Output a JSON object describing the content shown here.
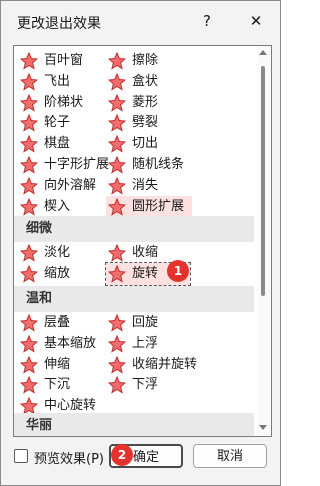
{
  "window": {
    "title": "更改退出效果",
    "help_label": "?",
    "close_label": "✕"
  },
  "groups": {
    "basic": {
      "items": [
        "百叶窗",
        "擦除",
        "飞出",
        "盒状",
        "阶梯状",
        "菱形",
        "轮子",
        "劈裂",
        "棋盘",
        "切出",
        "十字形扩展",
        "随机线条",
        "向外溶解",
        "消失",
        "楔入",
        "圆形扩展"
      ]
    },
    "subtle": {
      "label": "细微",
      "items": [
        "淡化",
        "收缩",
        "缩放",
        "旋转"
      ]
    },
    "moderate": {
      "label": "温和",
      "items": [
        "层叠",
        "回旋",
        "基本缩放",
        "上浮",
        "伸缩",
        "收缩并旋转",
        "下沉",
        "下浮",
        "中心旋转"
      ]
    },
    "exciting": {
      "label": "华丽"
    }
  },
  "selected_item": "旋转",
  "highlighted_item": "圆形扩展",
  "badges": {
    "selection": "1",
    "ok": "2"
  },
  "footer": {
    "preview_label": "预览效果(P)",
    "preview_checked": false,
    "ok_label": "确定",
    "cancel_label": "取消"
  },
  "colors": {
    "star_fill": "#f26d6d",
    "star_stroke": "#c42b2b",
    "highlight": "#fde1e1",
    "badge": "#e5322d"
  }
}
